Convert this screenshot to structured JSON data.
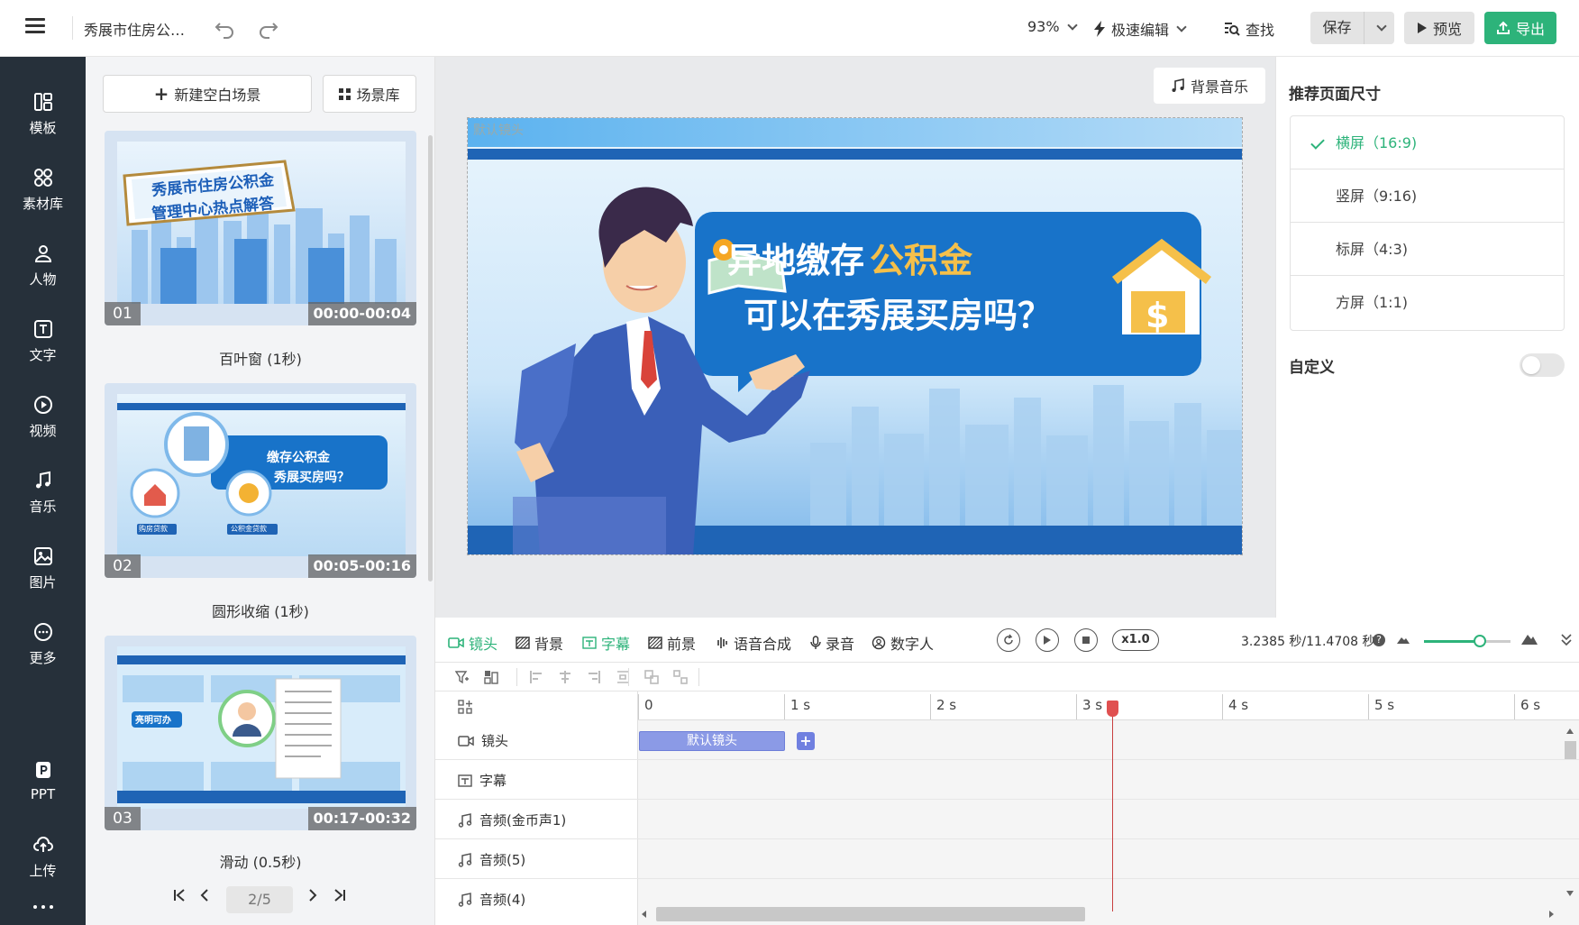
{
  "topbar": {
    "title": "秀展市住房公…",
    "zoom": "93%",
    "speed_edit": "极速编辑",
    "find": "查找",
    "save": "保存",
    "preview": "预览",
    "export": "导出"
  },
  "leftnav": {
    "items": [
      {
        "label": "模板"
      },
      {
        "label": "素材库"
      },
      {
        "label": "人物"
      },
      {
        "label": "文字"
      },
      {
        "label": "视频"
      },
      {
        "label": "音乐"
      },
      {
        "label": "图片"
      },
      {
        "label": "更多"
      },
      {
        "label": "PPT"
      },
      {
        "label": "上传"
      }
    ]
  },
  "scene_panel": {
    "new_blank": "新建空白场景",
    "library": "场景库",
    "scenes": [
      {
        "num": "01",
        "time": "00:00-00:04",
        "caption": "百叶窗 (1秒)",
        "thumb_text": [
          "秀展市住房公积金",
          "管理中心热点解答"
        ]
      },
      {
        "num": "02",
        "time": "00:05-00:16",
        "caption": "圆形收缩 (1秒)",
        "thumb_text": [
          "缴存公积金",
          "秀展买房吗？",
          "购房贷款",
          "公积金贷款"
        ]
      },
      {
        "num": "03",
        "time": "00:17-00:32",
        "caption": "滑动 (0.5秒)",
        "thumb_text": [
          "亮明可办"
        ]
      }
    ],
    "page": "2/5"
  },
  "canvas": {
    "bg_music": "背景音乐",
    "stage_label": "默认镜头",
    "headline_1a": "异地缴存",
    "headline_1b": "公积金",
    "headline_2": "可以在秀展买房吗？"
  },
  "right_panel": {
    "title": "推荐页面尺寸",
    "sizes": [
      {
        "label": "横屏（16:9)",
        "active": true
      },
      {
        "label": "竖屏（9:16)",
        "active": false
      },
      {
        "label": "标屏（4:3)",
        "active": false
      },
      {
        "label": "方屏（1:1)",
        "active": false
      }
    ],
    "custom": "自定义"
  },
  "timeline": {
    "tabs": [
      "镜头",
      "背景",
      "字幕",
      "前景",
      "语音合成",
      "录音",
      "数字人"
    ],
    "active_tab": "字幕",
    "speed": "x1.0",
    "time_readout": "3.2385 秒/11.4708 秒",
    "help": "?",
    "ruler_ticks": [
      "0",
      "1 s",
      "2 s",
      "3 s",
      "4 s",
      "5 s",
      "6 s"
    ],
    "tracks": [
      "镜头",
      "字幕",
      "音频(金币声1)",
      "音频(5)",
      "音频(4)"
    ],
    "clip_label": "默认镜头",
    "add_label": "+"
  },
  "colors": {
    "accent": "#2db37a",
    "sidebar": "#26303a",
    "clip": "#8b9ae6",
    "playhead": "#c94040"
  }
}
